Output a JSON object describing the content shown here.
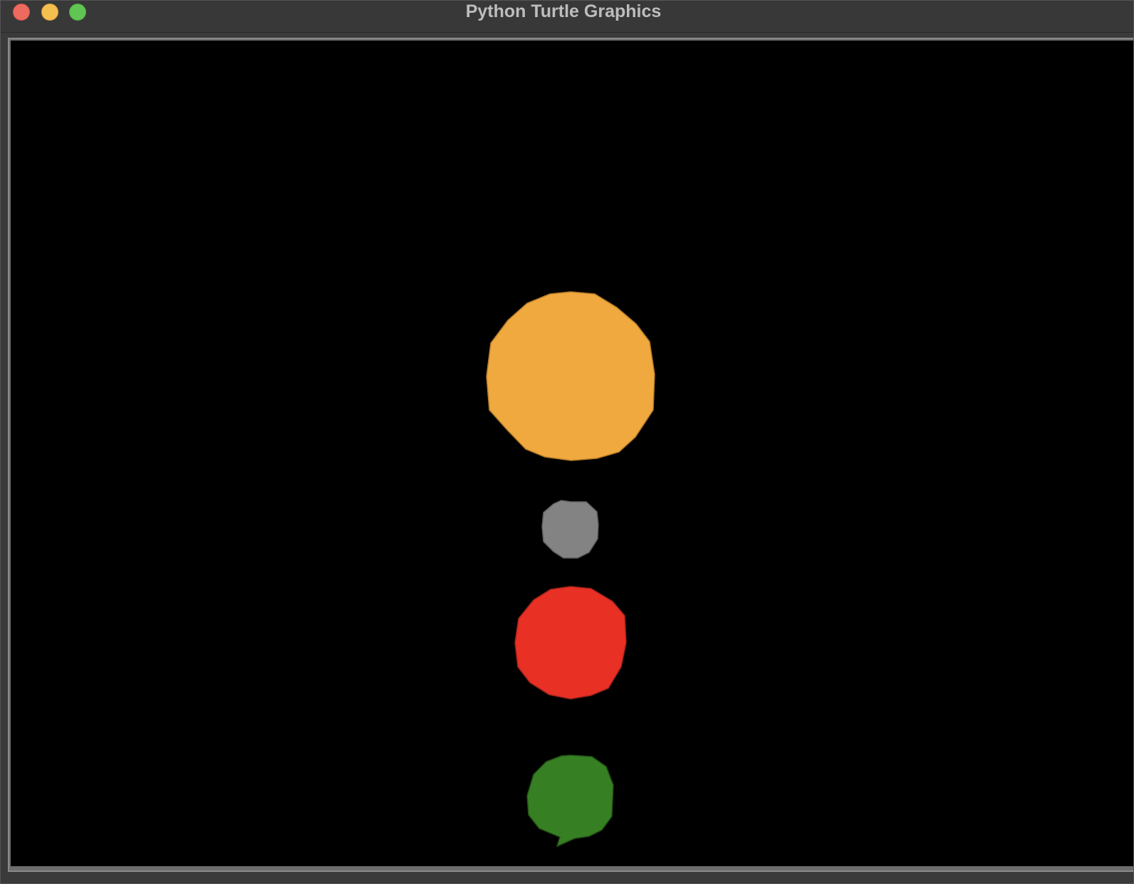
{
  "window": {
    "title": "Python Turtle Graphics"
  },
  "canvas": {
    "background": "#000000"
  },
  "shapes": [
    {
      "name": "orange-circle",
      "color": "#f0a93f"
    },
    {
      "name": "gray-circle",
      "color": "#838383"
    },
    {
      "name": "red-circle",
      "color": "#e83024"
    },
    {
      "name": "green-circle",
      "color": "#377f23"
    }
  ],
  "turtle": {
    "color": "#377f23",
    "icon": "arrow-cursor-icon"
  }
}
